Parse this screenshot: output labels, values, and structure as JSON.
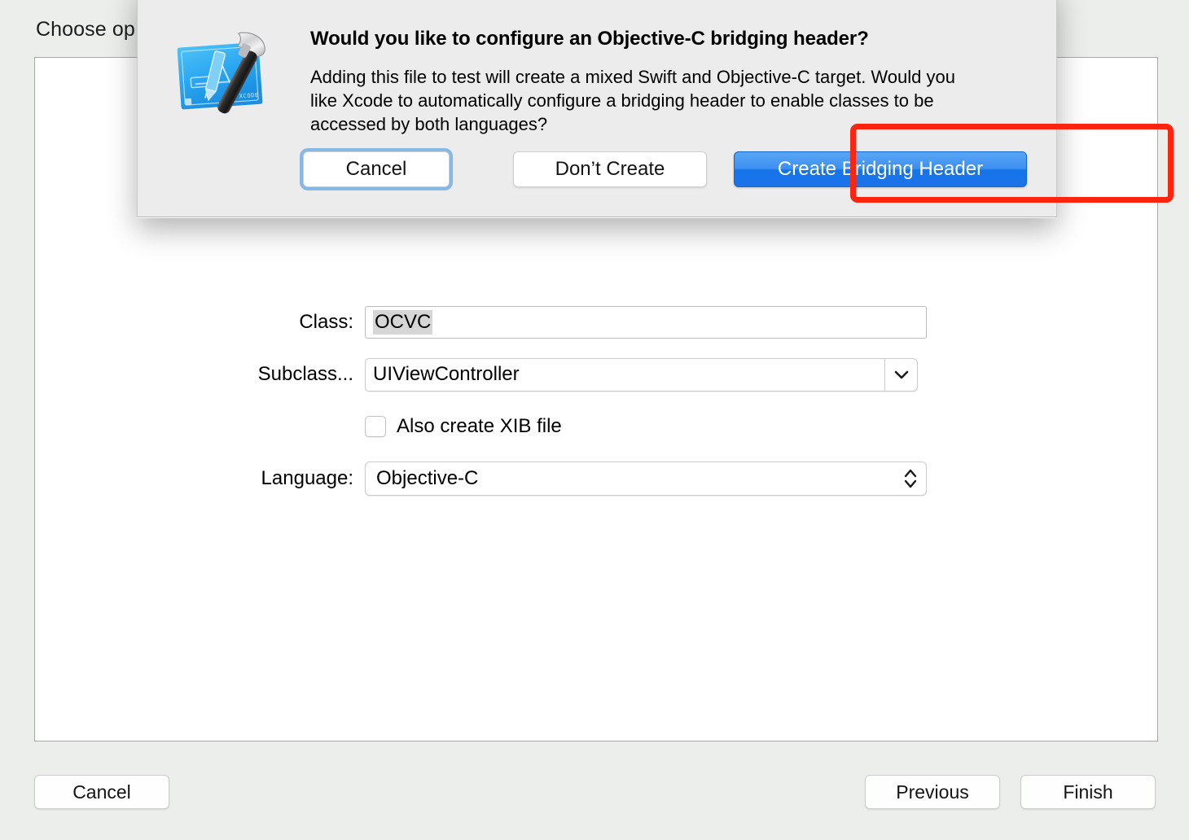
{
  "window": {
    "title": "Choose op",
    "bottom_bar": {
      "cancel_label": "Cancel",
      "previous_label": "Previous",
      "finish_label": "Finish"
    }
  },
  "form": {
    "class_label": "Class:",
    "class_value": "OCVC",
    "subclass_label": "Subclass...",
    "subclass_value": "UIViewController",
    "xib_checkbox_label": "Also create XIB file",
    "xib_checked": false,
    "language_label": "Language:",
    "language_value": "Objective-C"
  },
  "sheet": {
    "title": "Would you like to configure an Objective-C bridging header?",
    "body": "Adding this file to test will create a mixed Swift and Objective-C target. Would you like Xcode to automatically configure a bridging header to enable classes to be accessed by both languages?",
    "cancel_label": "Cancel",
    "dont_create_label": "Don’t Create",
    "create_label": "Create Bridging Header",
    "app_icon_name": "xcode-hammer-blueprint-icon"
  },
  "annotation": {
    "highlight_color": "#fd2410",
    "target": "create-bridging-header-button"
  },
  "colors": {
    "accent_blue": "#1e73e8",
    "focus_ring": "#64a8e3",
    "window_background": "#eceeec",
    "sheet_background": "#ececec",
    "selection_gray": "#d6d6d6"
  }
}
